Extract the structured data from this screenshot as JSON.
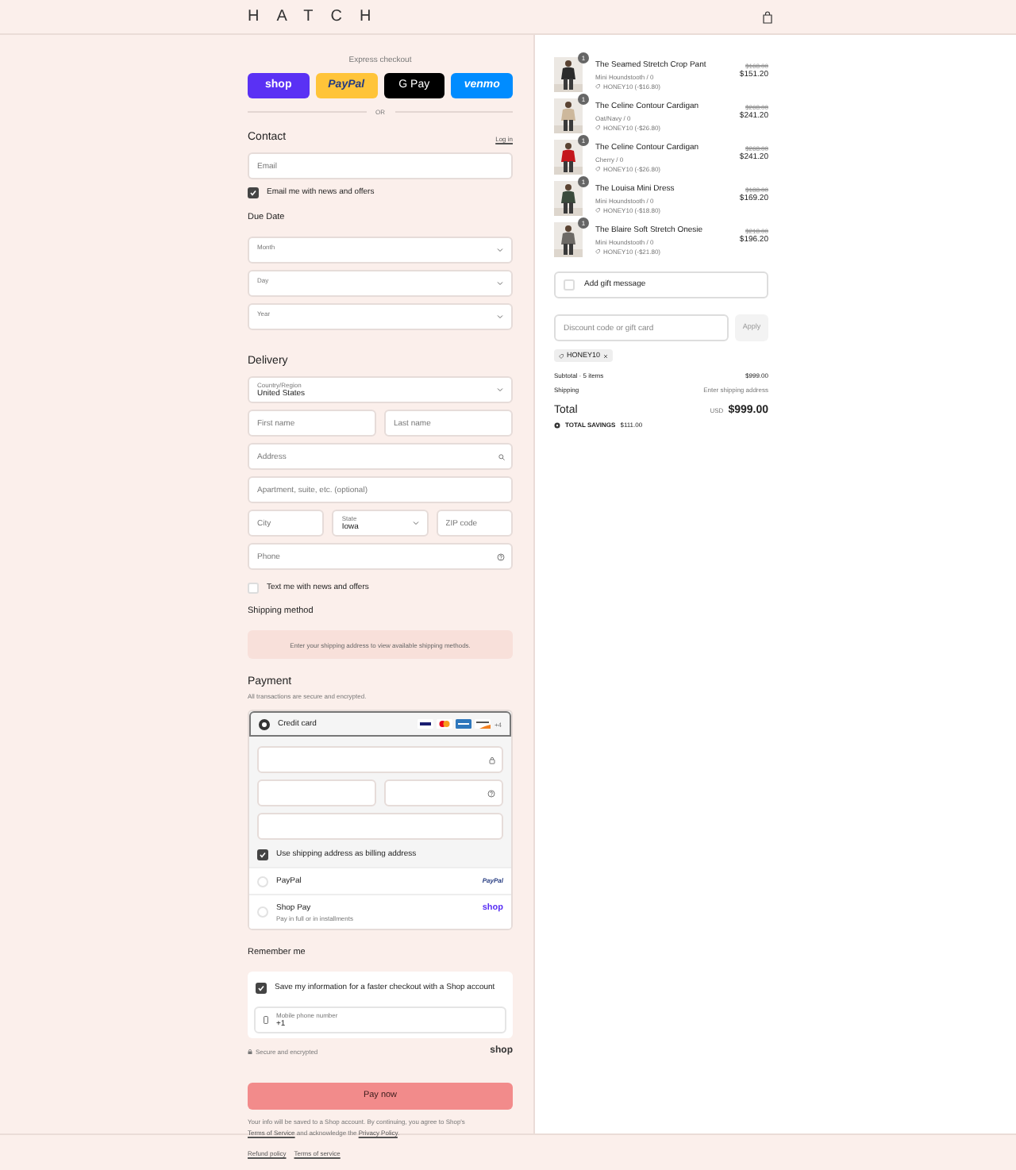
{
  "header": {
    "logo": "HATCH"
  },
  "express": {
    "label": "Express checkout",
    "buttons": [
      {
        "kind": "shop",
        "label": "shop"
      },
      {
        "kind": "paypal",
        "label": "PayPal"
      },
      {
        "kind": "gpay",
        "label": "G Pay"
      },
      {
        "kind": "venmo",
        "label": "venmo"
      }
    ],
    "divider": "OR"
  },
  "contact": {
    "title": "Contact",
    "login": "Log in",
    "email": {
      "placeholder": "Email"
    },
    "news": {
      "label": "Email me with news and offers",
      "checked": true
    }
  },
  "due_date": {
    "title": "Due Date",
    "selects": [
      {
        "label": "Month"
      },
      {
        "label": "Day"
      },
      {
        "label": "Year"
      }
    ]
  },
  "delivery": {
    "title": "Delivery",
    "rows": [
      [
        {
          "kind": "select",
          "label": "Country/Region",
          "value": "United States"
        }
      ],
      [
        {
          "kind": "input",
          "placeholder": "First name"
        },
        {
          "kind": "input",
          "placeholder": "Last name"
        }
      ],
      [
        {
          "kind": "search",
          "placeholder": "Address"
        }
      ],
      [
        {
          "kind": "input",
          "placeholder": "Apartment, suite, etc. (optional)"
        }
      ],
      [
        {
          "kind": "input",
          "placeholder": "City"
        },
        {
          "kind": "select",
          "label": "State",
          "value": "Iowa"
        },
        {
          "kind": "input",
          "placeholder": "ZIP code"
        }
      ],
      [
        {
          "kind": "help",
          "placeholder": "Phone"
        }
      ]
    ],
    "text_me": {
      "label": "Text me with news and offers",
      "checked": false
    }
  },
  "shipping": {
    "title": "Shipping method",
    "notice": "Enter your shipping address to view available shipping methods."
  },
  "payment": {
    "title": "Payment",
    "subtitle": "All transactions are secure and encrypted.",
    "methods": [
      {
        "kind": "card",
        "label": "Credit card",
        "selected": true,
        "more": "+4"
      },
      {
        "kind": "paypal",
        "label": "PayPal",
        "selected": false,
        "logo": "PayPal"
      },
      {
        "kind": "shoppay",
        "label": "Shop Pay",
        "selected": false,
        "note": "Pay in full or in installments",
        "logo": "shop"
      }
    ],
    "billing": {
      "label": "Use shipping address as billing address",
      "checked": true
    }
  },
  "remember": {
    "title": "Remember me",
    "save": {
      "label": "Save my information for a faster checkout with a Shop account",
      "checked": true
    },
    "phone": {
      "label": "Mobile phone number",
      "value": "+1"
    }
  },
  "secure": {
    "label": "Secure and encrypted",
    "logo": "shop"
  },
  "pay_button": "Pay now",
  "legal": [
    {
      "text": "Your info will be saved to a Shop account. By continuing, you agree to Shop's ",
      "link": false
    },
    {
      "text": "Terms of Service",
      "link": true
    },
    {
      "text": " and acknowledge the ",
      "link": false
    },
    {
      "text": "Privacy Policy",
      "link": true
    },
    {
      "text": ".",
      "link": false
    }
  ],
  "footer": {
    "links": [
      "Refund policy",
      "Terms of service"
    ]
  },
  "summary": {
    "items": [
      {
        "name": "The Seamed Stretch Crop Pant",
        "variant": "Mini Houndstooth / 0",
        "discount": "HONEY10 (-$16.80)",
        "original": "$168.00",
        "price": "$151.20",
        "quantity": "1"
      },
      {
        "name": "The Celine Contour Cardigan",
        "variant": "Oat/Navy / 0",
        "discount": "HONEY10 (-$26.80)",
        "original": "$268.00",
        "price": "$241.20",
        "quantity": "1"
      },
      {
        "name": "The Celine Contour Cardigan",
        "variant": "Cherry / 0",
        "discount": "HONEY10 (-$26.80)",
        "original": "$268.00",
        "price": "$241.20",
        "quantity": "1"
      },
      {
        "name": "The Louisa Mini Dress",
        "variant": "Mini Houndstooth / 0",
        "discount": "HONEY10 (-$18.80)",
        "original": "$188.00",
        "price": "$169.20",
        "quantity": "1"
      },
      {
        "name": "The Blaire Soft Stretch Onesie",
        "variant": "Mini Houndstooth / 0",
        "discount": "HONEY10 (-$21.80)",
        "original": "$218.00",
        "price": "$196.20",
        "quantity": "1"
      }
    ],
    "gift": {
      "label": "Add gift message",
      "checked": false
    },
    "discount": {
      "placeholder": "Discount code or gift card",
      "button": "Apply"
    },
    "code": "HONEY10",
    "subtotal_label": "Subtotal · 5 items",
    "subtotal": "$999.00",
    "shipping_label": "Shipping",
    "shipping": "Enter shipping address",
    "total_label": "Total",
    "currency": "USD",
    "total": "$999.00",
    "savings_label": "TOTAL SAVINGS",
    "savings": "$111.00"
  }
}
